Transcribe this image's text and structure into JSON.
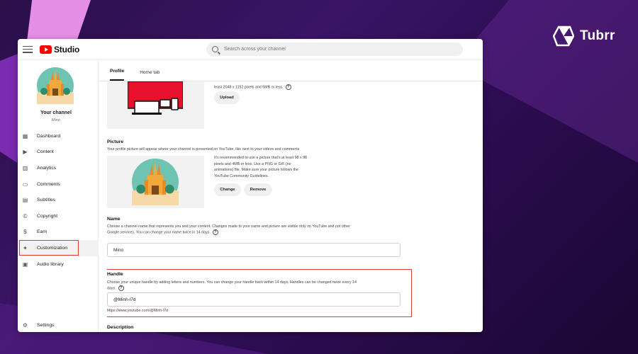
{
  "brand": {
    "name": "Tubrr"
  },
  "header": {
    "logo_text": "Studio",
    "search_placeholder": "Search across your channel"
  },
  "sidebar": {
    "channel_title": "Your channel",
    "channel_name": "Mino",
    "items": [
      {
        "label": "Dashboard",
        "icon": "dashboard-icon"
      },
      {
        "label": "Content",
        "icon": "content-icon"
      },
      {
        "label": "Analytics",
        "icon": "analytics-icon"
      },
      {
        "label": "Comments",
        "icon": "comments-icon"
      },
      {
        "label": "Subtitles",
        "icon": "subtitles-icon"
      },
      {
        "label": "Copyright",
        "icon": "copyright-icon"
      },
      {
        "label": "Earn",
        "icon": "dollar-icon"
      },
      {
        "label": "Customization",
        "icon": "magic-wand-icon"
      },
      {
        "label": "Audio library",
        "icon": "audio-library-icon"
      }
    ],
    "settings_label": "Settings",
    "active_item": "Customization"
  },
  "tabs": [
    {
      "label": "Profile",
      "active": true
    },
    {
      "label": "Home tab",
      "active": false
    }
  ],
  "banner": {
    "hint_text": "least 2048 x 1152 pixels and 6MB or less.",
    "upload_label": "Upload"
  },
  "picture": {
    "title": "Picture",
    "description": "Your profile picture will appear where your channel is presented on YouTube, like next to your videos and comments",
    "hint_line1": "It's recommended to use a picture that's at least 98 x 98",
    "hint_line2": "pixels and 4MB or less. Use a PNG or GIF (no",
    "hint_line3": "animations) file. Make sure your picture follows the",
    "hint_line4": "YouTube Community Guidelines.",
    "change_label": "Change",
    "remove_label": "Remove"
  },
  "name_section": {
    "title": "Name",
    "description_line1": "Choose a channel name that represents you and your content. Changes made to your name and picture are visible only on YouTube and not other",
    "description_line2": "Google services. You can change your name twice in 14 days.",
    "value": "Mino"
  },
  "handle_section": {
    "title": "Handle",
    "description_line1": "Choose your unique handle by adding letters and numbers. You can change your handle back within 14 days. Handles can be changed twice every 14",
    "description_line2": "days.",
    "value": "@Minh-l7d",
    "url": "https://www.youtube.com/@Minh-l7d"
  },
  "description_section": {
    "title": "Description"
  },
  "colors": {
    "accent_red": "#e53935",
    "youtube_red": "#ff0000",
    "background": "#2c0d52"
  }
}
